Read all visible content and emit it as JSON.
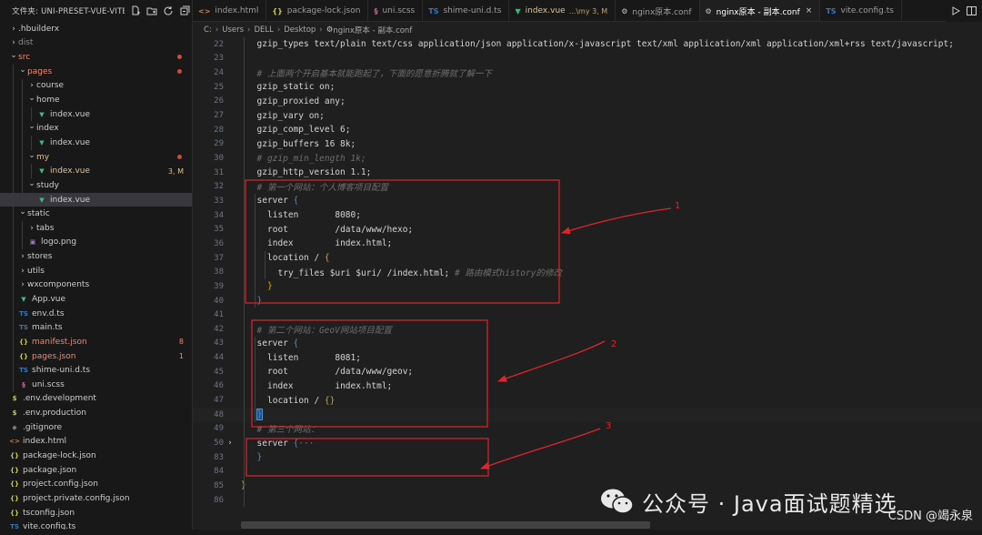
{
  "explorer": {
    "title": "文件夹: UNI-PRESET-VUE-VITE-...",
    "items": [
      {
        "label": ".hbuilderx",
        "type": "folder",
        "depth": 0,
        "open": false,
        "color": "#cccccc"
      },
      {
        "label": "dist",
        "type": "folder",
        "depth": 0,
        "open": false,
        "color": "#8c8c8c"
      },
      {
        "label": "src",
        "type": "folder",
        "depth": 0,
        "open": true,
        "color": "#f48771",
        "dot": true
      },
      {
        "label": "pages",
        "type": "folder",
        "depth": 1,
        "open": true,
        "color": "#f48771",
        "dot": true
      },
      {
        "label": "course",
        "type": "folder",
        "depth": 2,
        "open": false,
        "color": "#cccccc"
      },
      {
        "label": "home",
        "type": "folder",
        "depth": 2,
        "open": true,
        "color": "#cccccc"
      },
      {
        "label": "index.vue",
        "type": "vue",
        "depth": 3,
        "color": "#cccccc"
      },
      {
        "label": "index",
        "type": "folder",
        "depth": 2,
        "open": true,
        "color": "#cccccc"
      },
      {
        "label": "index.vue",
        "type": "vue",
        "depth": 3,
        "color": "#cccccc"
      },
      {
        "label": "my",
        "type": "folder",
        "depth": 2,
        "open": true,
        "color": "#e2c08d",
        "dot": true
      },
      {
        "label": "index.vue",
        "type": "vue",
        "depth": 3,
        "color": "#e2c08d",
        "badge": "3, M"
      },
      {
        "label": "study",
        "type": "folder",
        "depth": 2,
        "open": true,
        "color": "#cccccc"
      },
      {
        "label": "index.vue",
        "type": "vue",
        "depth": 3,
        "color": "#cccccc",
        "active": true
      },
      {
        "label": "static",
        "type": "folder",
        "depth": 1,
        "open": true,
        "color": "#cccccc"
      },
      {
        "label": "tabs",
        "type": "folder",
        "depth": 2,
        "open": false,
        "color": "#cccccc"
      },
      {
        "label": "logo.png",
        "type": "png",
        "depth": 2,
        "color": "#cccccc"
      },
      {
        "label": "stores",
        "type": "folder",
        "depth": 1,
        "open": false,
        "color": "#cccccc"
      },
      {
        "label": "utils",
        "type": "folder",
        "depth": 1,
        "open": false,
        "color": "#cccccc"
      },
      {
        "label": "wxcomponents",
        "type": "folder",
        "depth": 1,
        "open": false,
        "color": "#cccccc"
      },
      {
        "label": "App.vue",
        "type": "vue",
        "depth": 1,
        "color": "#cccccc"
      },
      {
        "label": "env.d.ts",
        "type": "ts",
        "depth": 1,
        "color": "#cccccc"
      },
      {
        "label": "main.ts",
        "type": "ts",
        "depth": 1,
        "color": "#cccccc"
      },
      {
        "label": "manifest.json",
        "type": "json",
        "depth": 1,
        "color": "#f48771",
        "badge": "8"
      },
      {
        "label": "pages.json",
        "type": "json",
        "depth": 1,
        "color": "#f48771",
        "badge": "1"
      },
      {
        "label": "shime-uni.d.ts",
        "type": "ts",
        "depth": 1,
        "color": "#cccccc"
      },
      {
        "label": "uni.scss",
        "type": "scss",
        "depth": 1,
        "color": "#cccccc"
      },
      {
        "label": ".env.development",
        "type": "env",
        "depth": 0,
        "color": "#cccccc"
      },
      {
        "label": ".env.production",
        "type": "env",
        "depth": 0,
        "color": "#cccccc"
      },
      {
        "label": ".gitignore",
        "type": "git",
        "depth": 0,
        "color": "#cccccc"
      },
      {
        "label": "index.html",
        "type": "html",
        "depth": 0,
        "color": "#cccccc"
      },
      {
        "label": "package-lock.json",
        "type": "json",
        "depth": 0,
        "color": "#cccccc"
      },
      {
        "label": "package.json",
        "type": "json",
        "depth": 0,
        "color": "#cccccc"
      },
      {
        "label": "project.config.json",
        "type": "json",
        "depth": 0,
        "color": "#cccccc"
      },
      {
        "label": "project.private.config.json",
        "type": "json",
        "depth": 0,
        "color": "#cccccc"
      },
      {
        "label": "tsconfig.json",
        "type": "json",
        "depth": 0,
        "color": "#cccccc"
      },
      {
        "label": "vite.config.ts",
        "type": "ts",
        "depth": 0,
        "color": "#cccccc"
      }
    ]
  },
  "icons": {
    "folder_closed": "›",
    "folder_open": "⌄",
    "vue": "▼",
    "ts": "TS",
    "json": "{}",
    "scss": "§",
    "html": "<>",
    "png": "▣",
    "env": "$",
    "git": "◆"
  },
  "icon_colors": {
    "vue": "#41b883",
    "ts": "#3178c6",
    "json": "#cbcb41",
    "scss": "#cd6799",
    "html": "#e37933",
    "png": "#a074c4",
    "env": "#cbcb41",
    "git": "#6d8086"
  },
  "tabs": [
    {
      "label": "index.html",
      "type": "html"
    },
    {
      "label": "package-lock.json",
      "type": "json"
    },
    {
      "label": "uni.scss",
      "type": "scss"
    },
    {
      "label": "shime-uni.d.ts",
      "type": "ts"
    },
    {
      "label": "index.vue",
      "type": "vue",
      "suffix": "...\\my 3, M",
      "modified": true
    },
    {
      "label": "nginx原本.conf",
      "type": "conf"
    },
    {
      "label": "nginx原本 - 副本.conf",
      "type": "conf",
      "active": true,
      "close": "×"
    },
    {
      "label": "vite.config.ts",
      "type": "ts"
    }
  ],
  "breadcrumb": [
    "C:",
    "Users",
    "DELL",
    "Desktop",
    "nginx原本 - 副本.conf"
  ],
  "code": [
    {
      "n": "22",
      "indent": 1,
      "parts": [
        [
          "kw",
          "gzip_types "
        ],
        [
          "val",
          "text/plain text/css application/json application/x-javascript text/xml application/xml application/xml+rss text/javascript;"
        ]
      ]
    },
    {
      "n": "23",
      "indent": 1,
      "parts": []
    },
    {
      "n": "24",
      "indent": 1,
      "parts": [
        [
          "cmg",
          "# 上面两个开启基本就能跑起了，下面的愿意折腾就了解一下"
        ]
      ]
    },
    {
      "n": "25",
      "indent": 1,
      "parts": [
        [
          "kw",
          "gzip_static "
        ],
        [
          "val",
          "on;"
        ]
      ]
    },
    {
      "n": "26",
      "indent": 1,
      "parts": [
        [
          "kw",
          "gzip_proxied "
        ],
        [
          "val",
          "any;"
        ]
      ]
    },
    {
      "n": "27",
      "indent": 1,
      "parts": [
        [
          "kw",
          "gzip_vary "
        ],
        [
          "val",
          "on;"
        ]
      ]
    },
    {
      "n": "28",
      "indent": 1,
      "parts": [
        [
          "kw",
          "gzip_comp_level "
        ],
        [
          "val",
          "6;"
        ]
      ]
    },
    {
      "n": "29",
      "indent": 1,
      "parts": [
        [
          "kw",
          "gzip_buffers "
        ],
        [
          "val",
          "16 8k;"
        ]
      ]
    },
    {
      "n": "30",
      "indent": 1,
      "parts": [
        [
          "cmg",
          "# gzip_min_length 1k;"
        ]
      ]
    },
    {
      "n": "31",
      "indent": 1,
      "parts": [
        [
          "kw",
          "gzip_http_version "
        ],
        [
          "val",
          "1.1;"
        ]
      ]
    },
    {
      "n": "32",
      "indent": 1,
      "parts": [
        [
          "cmg",
          "# 第一个网站：个人博客项目配置"
        ]
      ]
    },
    {
      "n": "33",
      "indent": 1,
      "parts": [
        [
          "kw",
          "server "
        ],
        [
          "br",
          "{"
        ]
      ]
    },
    {
      "n": "34",
      "indent": 2,
      "parts": [
        [
          "kw",
          "listen       "
        ],
        [
          "val",
          "8080;"
        ]
      ]
    },
    {
      "n": "35",
      "indent": 2,
      "parts": [
        [
          "kw",
          "root         "
        ],
        [
          "val",
          "/data/www/hexo;"
        ]
      ]
    },
    {
      "n": "36",
      "indent": 2,
      "parts": [
        [
          "kw",
          "index        "
        ],
        [
          "val",
          "index.html;"
        ]
      ]
    },
    {
      "n": "37",
      "indent": 2,
      "parts": [
        [
          "kw",
          "location / "
        ],
        [
          "br2",
          "{"
        ]
      ]
    },
    {
      "n": "38",
      "indent": 3,
      "parts": [
        [
          "kw",
          "try_files "
        ],
        [
          "val",
          "$uri $uri/ /index.html; "
        ],
        [
          "cmg",
          "# 路由模式history的修改"
        ]
      ]
    },
    {
      "n": "39",
      "indent": 2,
      "parts": [
        [
          "br2",
          "}"
        ]
      ]
    },
    {
      "n": "40",
      "indent": 1,
      "parts": [
        [
          "br",
          "}"
        ]
      ]
    },
    {
      "n": "41",
      "indent": 1,
      "parts": []
    },
    {
      "n": "42",
      "indent": 1,
      "parts": [
        [
          "cmg",
          "# 第二个网站：GeoV网站项目配置"
        ]
      ]
    },
    {
      "n": "43",
      "indent": 1,
      "parts": [
        [
          "kw",
          "server "
        ],
        [
          "br",
          "{"
        ]
      ]
    },
    {
      "n": "44",
      "indent": 2,
      "parts": [
        [
          "kw",
          "listen       "
        ],
        [
          "val",
          "8081;"
        ]
      ]
    },
    {
      "n": "45",
      "indent": 2,
      "parts": [
        [
          "kw",
          "root         "
        ],
        [
          "val",
          "/data/www/geov;"
        ]
      ]
    },
    {
      "n": "46",
      "indent": 2,
      "parts": [
        [
          "kw",
          "index        "
        ],
        [
          "val",
          "index.html;"
        ]
      ]
    },
    {
      "n": "47",
      "indent": 2,
      "parts": [
        [
          "kw",
          "location / "
        ],
        [
          "br2",
          "{}"
        ]
      ]
    },
    {
      "n": "48",
      "indent": 1,
      "parts": [
        [
          "br",
          "}"
        ]
      ],
      "current": true
    },
    {
      "n": "49",
      "indent": 1,
      "parts": [
        [
          "cmg",
          "# 第三个网站："
        ]
      ]
    },
    {
      "n": "50",
      "indent": 1,
      "parts": [
        [
          "kw",
          "server "
        ],
        [
          "br",
          "{"
        ],
        [
          "cmg",
          "···"
        ]
      ],
      "fold": "›"
    },
    {
      "n": "83",
      "indent": 1,
      "parts": [
        [
          "br",
          "}"
        ]
      ]
    },
    {
      "n": "84",
      "indent": 1,
      "parts": []
    },
    {
      "n": "85",
      "indent": 0,
      "parts": [
        [
          "br2",
          "}"
        ]
      ]
    },
    {
      "n": "86",
      "indent": 0,
      "parts": []
    }
  ],
  "annotations": [
    "1",
    "2",
    "3"
  ],
  "watermark": {
    "text": "公众号 · Java面试题精选",
    "csdn": "CSDN @竭永泉"
  },
  "colors": {
    "annotation": "#e0242b",
    "accent_vue": "#41b883"
  }
}
